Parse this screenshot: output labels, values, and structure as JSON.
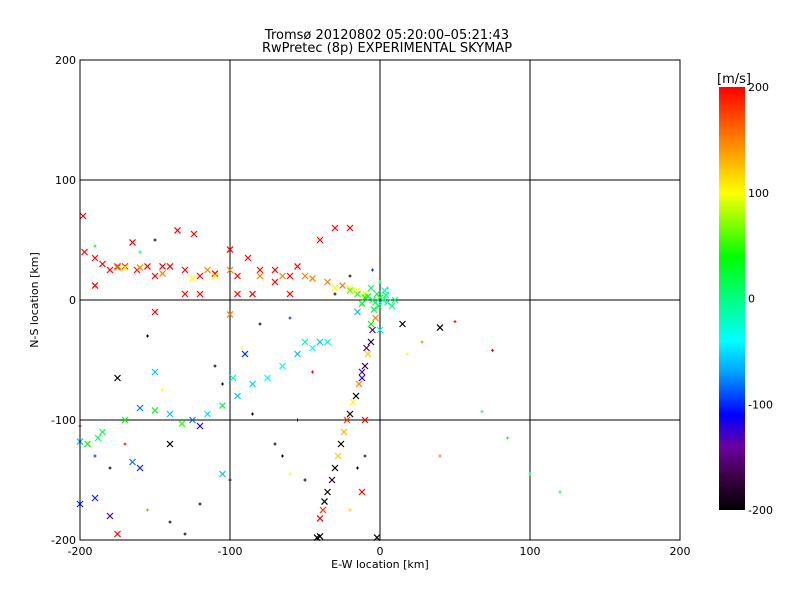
{
  "chart_data": {
    "type": "scatter",
    "title": "Tromsø 20120802 05:20:00–05:21:43",
    "subtitle": "RwPretec (8p) EXPERIMENTAL SKYMAP",
    "xlabel": "E-W location [km]",
    "ylabel": "N-S location [km]",
    "xlim": [
      -200,
      200
    ],
    "ylim": [
      -200,
      200
    ],
    "xticks": [
      "-200",
      "-100",
      "0",
      "100",
      "200"
    ],
    "yticks": [
      "-200",
      "-100",
      "0",
      "100",
      "200"
    ],
    "grid": true,
    "colorbar": {
      "label": "[m/s]",
      "range": [
        -200,
        200
      ],
      "ticks": [
        "-200",
        "-100",
        "0",
        "100",
        "200"
      ],
      "stops": [
        [
          -200,
          "#000000"
        ],
        [
          -170,
          "#3a0040"
        ],
        [
          -140,
          "#6a00a0"
        ],
        [
          -110,
          "#0000ff"
        ],
        [
          -70,
          "#00a0ff"
        ],
        [
          -40,
          "#00ffff"
        ],
        [
          0,
          "#00ff80"
        ],
        [
          40,
          "#00ff00"
        ],
        [
          100,
          "#ffff00"
        ],
        [
          150,
          "#ff8000"
        ],
        [
          200,
          "#ff0000"
        ]
      ]
    },
    "points_format": [
      "x_km",
      "y_km",
      "velocity_m_s",
      "marker(1=cross,0=dot)"
    ],
    "points": [
      [
        -198,
        70,
        200,
        1
      ],
      [
        -197,
        40,
        200,
        1
      ],
      [
        -190,
        35,
        200,
        1
      ],
      [
        -185,
        30,
        200,
        1
      ],
      [
        -180,
        25,
        200,
        1
      ],
      [
        -170,
        28,
        200,
        1
      ],
      [
        -162,
        25,
        200,
        1
      ],
      [
        -155,
        28,
        200,
        1
      ],
      [
        -150,
        20,
        200,
        1
      ],
      [
        -145,
        28,
        200,
        1
      ],
      [
        -140,
        28,
        200,
        1
      ],
      [
        -130,
        25,
        200,
        1
      ],
      [
        -124,
        55,
        200,
        1
      ],
      [
        -120,
        20,
        200,
        1
      ],
      [
        -110,
        22,
        200,
        1
      ],
      [
        -100,
        42,
        200,
        1
      ],
      [
        -95,
        20,
        200,
        1
      ],
      [
        -88,
        35,
        200,
        1
      ],
      [
        -80,
        25,
        200,
        1
      ],
      [
        -70,
        25,
        200,
        1
      ],
      [
        -60,
        20,
        200,
        1
      ],
      [
        -55,
        28,
        200,
        1
      ],
      [
        -40,
        50,
        200,
        1
      ],
      [
        -30,
        60,
        200,
        1
      ],
      [
        -20,
        60,
        200,
        1
      ],
      [
        -130,
        5,
        200,
        1
      ],
      [
        -150,
        -10,
        200,
        1
      ],
      [
        -120,
        5,
        200,
        1
      ],
      [
        -95,
        5,
        200,
        1
      ],
      [
        -85,
        5,
        200,
        1
      ],
      [
        -70,
        15,
        200,
        1
      ],
      [
        -60,
        5,
        200,
        1
      ],
      [
        -190,
        12,
        200,
        1
      ],
      [
        -175,
        28,
        200,
        1
      ],
      [
        -135,
        58,
        200,
        1
      ],
      [
        -165,
        48,
        200,
        1
      ],
      [
        -175,
        27,
        150,
        1
      ],
      [
        -160,
        27,
        150,
        1
      ],
      [
        -145,
        22,
        150,
        1
      ],
      [
        -115,
        25,
        150,
        1
      ],
      [
        -100,
        25,
        150,
        1
      ],
      [
        -80,
        20,
        150,
        1
      ],
      [
        -65,
        20,
        150,
        1
      ],
      [
        -50,
        20,
        150,
        1
      ],
      [
        -45,
        18,
        150,
        1
      ],
      [
        -35,
        15,
        150,
        1
      ],
      [
        -25,
        12,
        150,
        1
      ],
      [
        -30,
        10,
        100,
        1
      ],
      [
        -20,
        10,
        100,
        1
      ],
      [
        -15,
        8,
        100,
        1
      ],
      [
        -10,
        5,
        100,
        1
      ],
      [
        -170,
        27,
        100,
        1
      ],
      [
        -125,
        18,
        100,
        1
      ],
      [
        -110,
        20,
        100,
        1
      ],
      [
        -8,
        3,
        20,
        1
      ],
      [
        -5,
        0,
        0,
        1
      ],
      [
        -3,
        -2,
        10,
        1
      ],
      [
        0,
        2,
        30,
        1
      ],
      [
        2,
        0,
        0,
        1
      ],
      [
        -10,
        2,
        40,
        1
      ],
      [
        5,
        -2,
        -10,
        1
      ],
      [
        -2,
        5,
        20,
        1
      ],
      [
        -15,
        5,
        50,
        1
      ],
      [
        -20,
        8,
        60,
        1
      ],
      [
        -6,
        10,
        10,
        1
      ],
      [
        3,
        8,
        -20,
        1
      ],
      [
        8,
        -5,
        0,
        1
      ],
      [
        -12,
        -3,
        30,
        1
      ],
      [
        -1,
        -5,
        10,
        1
      ],
      [
        4,
        4,
        0,
        1
      ],
      [
        -4,
        -8,
        20,
        1
      ],
      [
        10,
        0,
        10,
        1
      ],
      [
        -3,
        -15,
        150,
        1
      ],
      [
        -5,
        -25,
        -150,
        1
      ],
      [
        -6,
        -35,
        -180,
        1
      ],
      [
        -8,
        -45,
        120,
        1
      ],
      [
        -10,
        -55,
        -170,
        1
      ],
      [
        -12,
        -60,
        -130,
        1
      ],
      [
        -14,
        -70,
        150,
        1
      ],
      [
        -16,
        -80,
        -200,
        1
      ],
      [
        -18,
        -85,
        100,
        1
      ],
      [
        -20,
        -95,
        -190,
        1
      ],
      [
        -22,
        -100,
        180,
        1
      ],
      [
        -24,
        -110,
        130,
        1
      ],
      [
        -26,
        -120,
        -200,
        1
      ],
      [
        -28,
        -130,
        120,
        1
      ],
      [
        -30,
        -140,
        -200,
        1
      ],
      [
        -32,
        -150,
        -180,
        1
      ],
      [
        -35,
        -160,
        -200,
        1
      ],
      [
        -37,
        -168,
        -200,
        1
      ],
      [
        -38,
        -175,
        180,
        1
      ],
      [
        -40,
        -182,
        200,
        1
      ],
      [
        -42,
        -198,
        -200,
        1
      ],
      [
        -12,
        -65,
        -120,
        1
      ],
      [
        -6,
        -20,
        40,
        1
      ],
      [
        -9,
        -40,
        -160,
        1
      ],
      [
        -35,
        -35,
        -20,
        1
      ],
      [
        -45,
        -40,
        -40,
        1
      ],
      [
        -55,
        -45,
        -60,
        1
      ],
      [
        -65,
        -55,
        -30,
        1
      ],
      [
        -75,
        -65,
        -40,
        1
      ],
      [
        -85,
        -70,
        -50,
        1
      ],
      [
        -95,
        -80,
        -60,
        1
      ],
      [
        -105,
        -88,
        20,
        1
      ],
      [
        -115,
        -95,
        -50,
        1
      ],
      [
        -125,
        -100,
        -80,
        1
      ],
      [
        -140,
        -95,
        -60,
        1
      ],
      [
        -150,
        -92,
        30,
        1
      ],
      [
        -160,
        -90,
        -80,
        1
      ],
      [
        -170,
        -100,
        40,
        1
      ],
      [
        -185,
        -110,
        20,
        1
      ],
      [
        -195,
        -120,
        40,
        1
      ],
      [
        -200,
        -118,
        -60,
        1
      ],
      [
        -188,
        -115,
        10,
        1
      ],
      [
        -132,
        -103,
        50,
        1
      ],
      [
        -175,
        -65,
        -200,
        1
      ],
      [
        -160,
        -140,
        -100,
        1
      ],
      [
        -165,
        -135,
        -80,
        1
      ],
      [
        -140,
        -120,
        -200,
        1
      ],
      [
        -120,
        -105,
        -120,
        1
      ],
      [
        -105,
        -145,
        -60,
        1
      ],
      [
        -180,
        -180,
        -130,
        1
      ],
      [
        -190,
        -165,
        -100,
        1
      ],
      [
        -175,
        -195,
        200,
        1
      ],
      [
        -200,
        -170,
        -100,
        1
      ],
      [
        40,
        -23,
        -200,
        1
      ],
      [
        15,
        -20,
        -200,
        1
      ],
      [
        -2,
        -198,
        -200,
        1
      ],
      [
        -40,
        -197,
        -200,
        1
      ],
      [
        -12,
        -160,
        200,
        1
      ],
      [
        -10,
        -100,
        200,
        1
      ],
      [
        -90,
        -45,
        -100,
        1
      ],
      [
        -100,
        -12,
        150,
        1
      ],
      [
        -98,
        -65,
        -20,
        1
      ],
      [
        -40,
        -35,
        -60,
        1
      ],
      [
        -15,
        -10,
        -60,
        1
      ],
      [
        0,
        -25,
        -30,
        1
      ],
      [
        -50,
        -35,
        -20,
        1
      ],
      [
        -150,
        -60,
        -60,
        1
      ],
      [
        120,
        -160,
        20,
        0
      ],
      [
        85,
        -115,
        20,
        0
      ],
      [
        100,
        -145,
        20,
        0
      ],
      [
        68,
        -93,
        0,
        0
      ],
      [
        50,
        -18,
        200,
        0
      ],
      [
        75,
        -42,
        200,
        0
      ],
      [
        40,
        -130,
        150,
        0
      ],
      [
        28,
        -35,
        150,
        0
      ],
      [
        18,
        -45,
        100,
        0
      ],
      [
        -50,
        -150,
        -200,
        0
      ],
      [
        -65,
        -130,
        -200,
        0
      ],
      [
        -100,
        -150,
        -200,
        0
      ],
      [
        -85,
        -95,
        -200,
        0
      ],
      [
        -130,
        -195,
        -200,
        0
      ],
      [
        -140,
        -185,
        -200,
        0
      ],
      [
        -170,
        -120,
        200,
        0
      ],
      [
        -70,
        -120,
        -200,
        0
      ],
      [
        -55,
        -100,
        -180,
        0
      ],
      [
        -105,
        -70,
        -200,
        0
      ],
      [
        -110,
        -55,
        -200,
        0
      ],
      [
        -20,
        -175,
        120,
        0
      ],
      [
        -15,
        -140,
        -200,
        0
      ],
      [
        -10,
        -130,
        -180,
        0
      ],
      [
        -145,
        -75,
        100,
        0
      ],
      [
        -155,
        -30,
        -200,
        0
      ],
      [
        -80,
        -20,
        -200,
        0
      ],
      [
        -190,
        45,
        40,
        0
      ],
      [
        -160,
        40,
        20,
        0
      ],
      [
        -150,
        50,
        -200,
        0
      ],
      [
        -30,
        5,
        -200,
        0
      ],
      [
        -20,
        20,
        -200,
        0
      ],
      [
        -5,
        25,
        -100,
        0
      ],
      [
        0,
        15,
        40,
        0
      ],
      [
        5,
        10,
        -20,
        0
      ],
      [
        -92,
        -40,
        100,
        0
      ],
      [
        -60,
        -15,
        -100,
        0
      ],
      [
        -45,
        -60,
        200,
        0
      ],
      [
        -60,
        -145,
        100,
        0
      ],
      [
        -120,
        -170,
        -200,
        0
      ],
      [
        -190,
        -130,
        -100,
        0
      ],
      [
        -200,
        -105,
        200,
        0
      ],
      [
        -180,
        -140,
        -200,
        0
      ],
      [
        -155,
        -175,
        150,
        0
      ]
    ]
  }
}
